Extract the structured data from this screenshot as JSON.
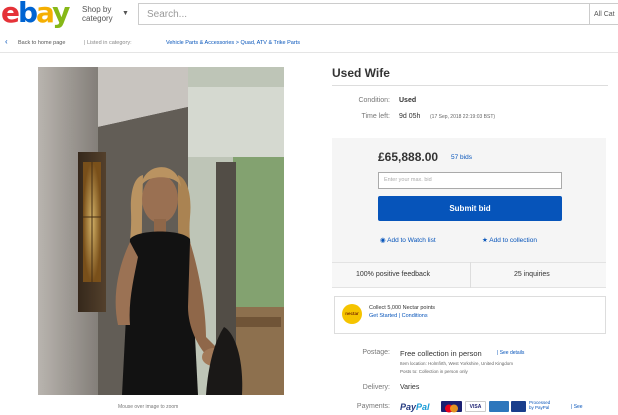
{
  "header": {
    "logo": [
      "e",
      "b",
      "a",
      "y"
    ],
    "shop_by": [
      "Shop by",
      "category"
    ],
    "search_placeholder": "Search...",
    "all_categories": "All Cat"
  },
  "breadcrumb": {
    "back": "Back to home page",
    "listed_in": "| Listed in category:",
    "path": "Vehicle Parts & Accessories  >  Quad, ATV & Trike Parts"
  },
  "gallery": {
    "caption": "Mouse over image to zoom"
  },
  "listing": {
    "title": "Used Wife",
    "condition_label": "Condition:",
    "condition_value": "Used",
    "time_left_label": "Time left:",
    "time_left_value": "9d 05h",
    "time_left_detail": "(17 Sep, 2018   22:19:03 BST)"
  },
  "bid": {
    "price": "£65,888.00",
    "bids": "57 bids",
    "input_placeholder": "Enter your max. bid",
    "submit": "Submit bid",
    "watch": "Add to Watch list",
    "collection": "Add to collection"
  },
  "seller": {
    "feedback": "100% positive feedback",
    "inquiries": "25 inquiries"
  },
  "nectar": {
    "logo": "nectar",
    "collect": "Collect 5,000 Nectar points",
    "links": "Get Started  |  Conditions"
  },
  "postage": {
    "label": "Postage:",
    "value": "Free collection in person",
    "see_details": "| See details",
    "location": "Item location:  Holmfirth, West Yorkshire, United Kingdom",
    "posts_to": "Posts to:  Collection in person only"
  },
  "delivery": {
    "label": "Delivery:",
    "value": "Varies"
  },
  "payments": {
    "label": "Payments:",
    "paypal": [
      "Pay",
      "Pal"
    ],
    "processed": [
      "Processed",
      "by PayPal"
    ],
    "see": "| See"
  },
  "colors": {
    "link": "#0654ba",
    "submit": "#0654ba",
    "bid_panel": "#f5f5f5"
  }
}
